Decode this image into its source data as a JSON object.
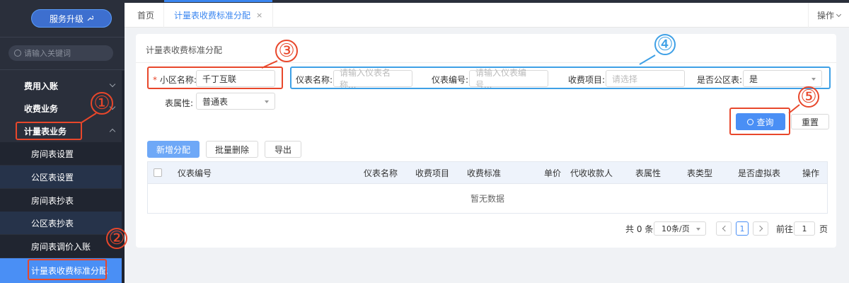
{
  "sidebar": {
    "upgrade_label": "服务升级",
    "upgrade_icon": "wrench-icon",
    "search_placeholder": "请输入关键词",
    "groups": [
      {
        "label": "费用入账",
        "expanded": false
      },
      {
        "label": "收费业务",
        "expanded": false
      },
      {
        "label": "计量表业务",
        "expanded": true
      }
    ],
    "subitems": [
      {
        "label": "房间表设置"
      },
      {
        "label": "公区表设置"
      },
      {
        "label": "房间表抄表"
      },
      {
        "label": "公区表抄表"
      },
      {
        "label": "房间表调价入账"
      },
      {
        "label": "计量表收费标准分配",
        "active": true
      }
    ]
  },
  "tabs": {
    "home": "首页",
    "current": "计量表收费标准分配",
    "close": "×",
    "ops": "操作"
  },
  "panel": {
    "title": "计量表收费标准分配"
  },
  "form": {
    "required_mark": "*",
    "community_label": "小区名称:",
    "community_value": "千丁互联",
    "meter_name_label": "仪表名称:",
    "meter_name_placeholder": "请输入仪表名称...",
    "meter_no_label": "仪表编号:",
    "meter_no_placeholder": "请输入仪表编号...",
    "fee_item_label": "收费项目:",
    "fee_item_placeholder": "请选择",
    "public_label": "是否公区表:",
    "public_value": "是",
    "attr_label": "表属性:",
    "attr_value": "普通表",
    "query_label": "查询",
    "reset_label": "重置"
  },
  "toolbar": {
    "add_label": "新增分配",
    "batch_delete_label": "批量删除",
    "export_label": "导出"
  },
  "table": {
    "columns": [
      "仪表编号",
      "仪表名称",
      "收费项目",
      "收费标准",
      "单价",
      "代收收款人",
      "表属性",
      "表类型",
      "是否虚拟表",
      "操作"
    ],
    "empty_text": "暂无数据"
  },
  "pagination": {
    "total": "共 0 条",
    "page_size": "10条/页",
    "current_page": "1",
    "goto_label": "前往",
    "goto_value": "1",
    "page_unit": "页"
  },
  "annotations": [
    "①",
    "②",
    "③",
    "④",
    "⑤"
  ],
  "colors": {
    "sidebar_bg": "#2a2f3b",
    "accent": "#4a8ff5",
    "annotation_red": "#e8472b",
    "annotation_blue": "#3ea0e6"
  }
}
